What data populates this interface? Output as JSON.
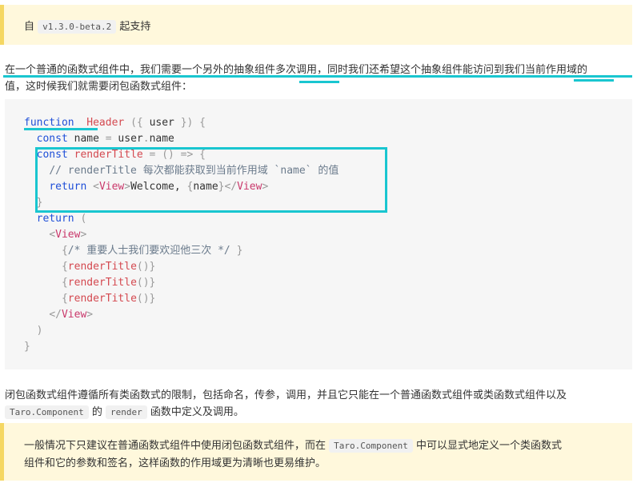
{
  "tip_top": {
    "prefix": "自",
    "version": "v1.3.0-beta.2",
    "suffix": "起支持"
  },
  "intro": {
    "line1": "在一个普通的函数式组件中，我们需要一个另外的抽象组件多次调用，同时我们还希望这个抽象组件能访问到我们当前作用域的",
    "line2": "值，这时候我们就需要闭包函数式组件："
  },
  "code": {
    "lines": [
      [
        [
          "kw",
          "function"
        ],
        [
          "",
          "  "
        ],
        [
          "fn",
          "Header"
        ],
        [
          "pn",
          " ({ "
        ],
        [
          "",
          "user"
        ],
        [
          "pn",
          " }) {"
        ]
      ],
      [
        [
          "",
          "  "
        ],
        [
          "kw",
          "const"
        ],
        [
          "",
          " name "
        ],
        [
          "pn",
          "="
        ],
        [
          "",
          " user"
        ],
        [
          "pn",
          "."
        ],
        [
          "",
          "name"
        ]
      ],
      [
        [
          "",
          "  "
        ],
        [
          "kw",
          "const"
        ],
        [
          "",
          " "
        ],
        [
          "fn",
          "renderTitle"
        ],
        [
          "pn",
          " = () => {"
        ]
      ],
      [
        [
          "",
          "    "
        ],
        [
          "cm",
          "// renderTitle 每次都能获取到当前作用域 `name` 的值"
        ]
      ],
      [
        [
          "",
          "    "
        ],
        [
          "kw",
          "return"
        ],
        [
          "",
          " "
        ],
        [
          "pn",
          "<"
        ],
        [
          "tag",
          "View"
        ],
        [
          "pn",
          ">"
        ],
        [
          "",
          "Welcome, "
        ],
        [
          "pn",
          "{"
        ],
        [
          "",
          "name"
        ],
        [
          "pn",
          "}</"
        ],
        [
          "tag",
          "View"
        ],
        [
          "pn",
          ">"
        ]
      ],
      [
        [
          "",
          "  "
        ],
        [
          "pn",
          "}"
        ]
      ],
      [
        [
          "",
          "  "
        ],
        [
          "kw",
          "return"
        ],
        [
          "pn",
          " ("
        ]
      ],
      [
        [
          "",
          "    "
        ],
        [
          "pn",
          "<"
        ],
        [
          "tag",
          "View"
        ],
        [
          "pn",
          ">"
        ]
      ],
      [
        [
          "",
          "      "
        ],
        [
          "pn",
          "{"
        ],
        [
          "cm",
          "/* 重要人士我们要欢迎他三次 */"
        ],
        [
          "pn",
          " }"
        ]
      ],
      [
        [
          "",
          "      "
        ],
        [
          "pn",
          "{"
        ],
        [
          "fn",
          "renderTitle"
        ],
        [
          "pn",
          "()}"
        ]
      ],
      [
        [
          "",
          "      "
        ],
        [
          "pn",
          "{"
        ],
        [
          "fn",
          "renderTitle"
        ],
        [
          "pn",
          "()}"
        ]
      ],
      [
        [
          "",
          "      "
        ],
        [
          "pn",
          "{"
        ],
        [
          "fn",
          "renderTitle"
        ],
        [
          "pn",
          "()}"
        ]
      ],
      [
        [
          "",
          "    "
        ],
        [
          "pn",
          "</"
        ],
        [
          "tag",
          "View"
        ],
        [
          "pn",
          ">"
        ]
      ],
      [
        [
          "",
          "  "
        ],
        [
          "pn",
          ")"
        ]
      ],
      [
        [
          "pn",
          "}"
        ]
      ]
    ]
  },
  "outro": {
    "line1": "闭包函数式组件遵循所有类函数式的限制，包括命名，传参，调用，并且它只能在一个普通函数式组件或类函数式组件以及",
    "component_code": "Taro.Component",
    "word_of": "的",
    "render_code": "render",
    "line2_suffix": "函数中定义及调用。"
  },
  "tip_bottom": {
    "line1_prefix": "一般情况下只建议在普通函数式组件中使用闭包函数式组件，而在",
    "line1_code": "Taro.Component",
    "line1_suffix": "中可以显式地定义一个类函数式",
    "line2": "组件和它的参数和签名，这样函数的作用域更为清晰也更易维护。"
  },
  "colors": {
    "highlight": "#19c6d0",
    "tip_border": "#f5d762",
    "tip_bg": "#fff8dc"
  }
}
